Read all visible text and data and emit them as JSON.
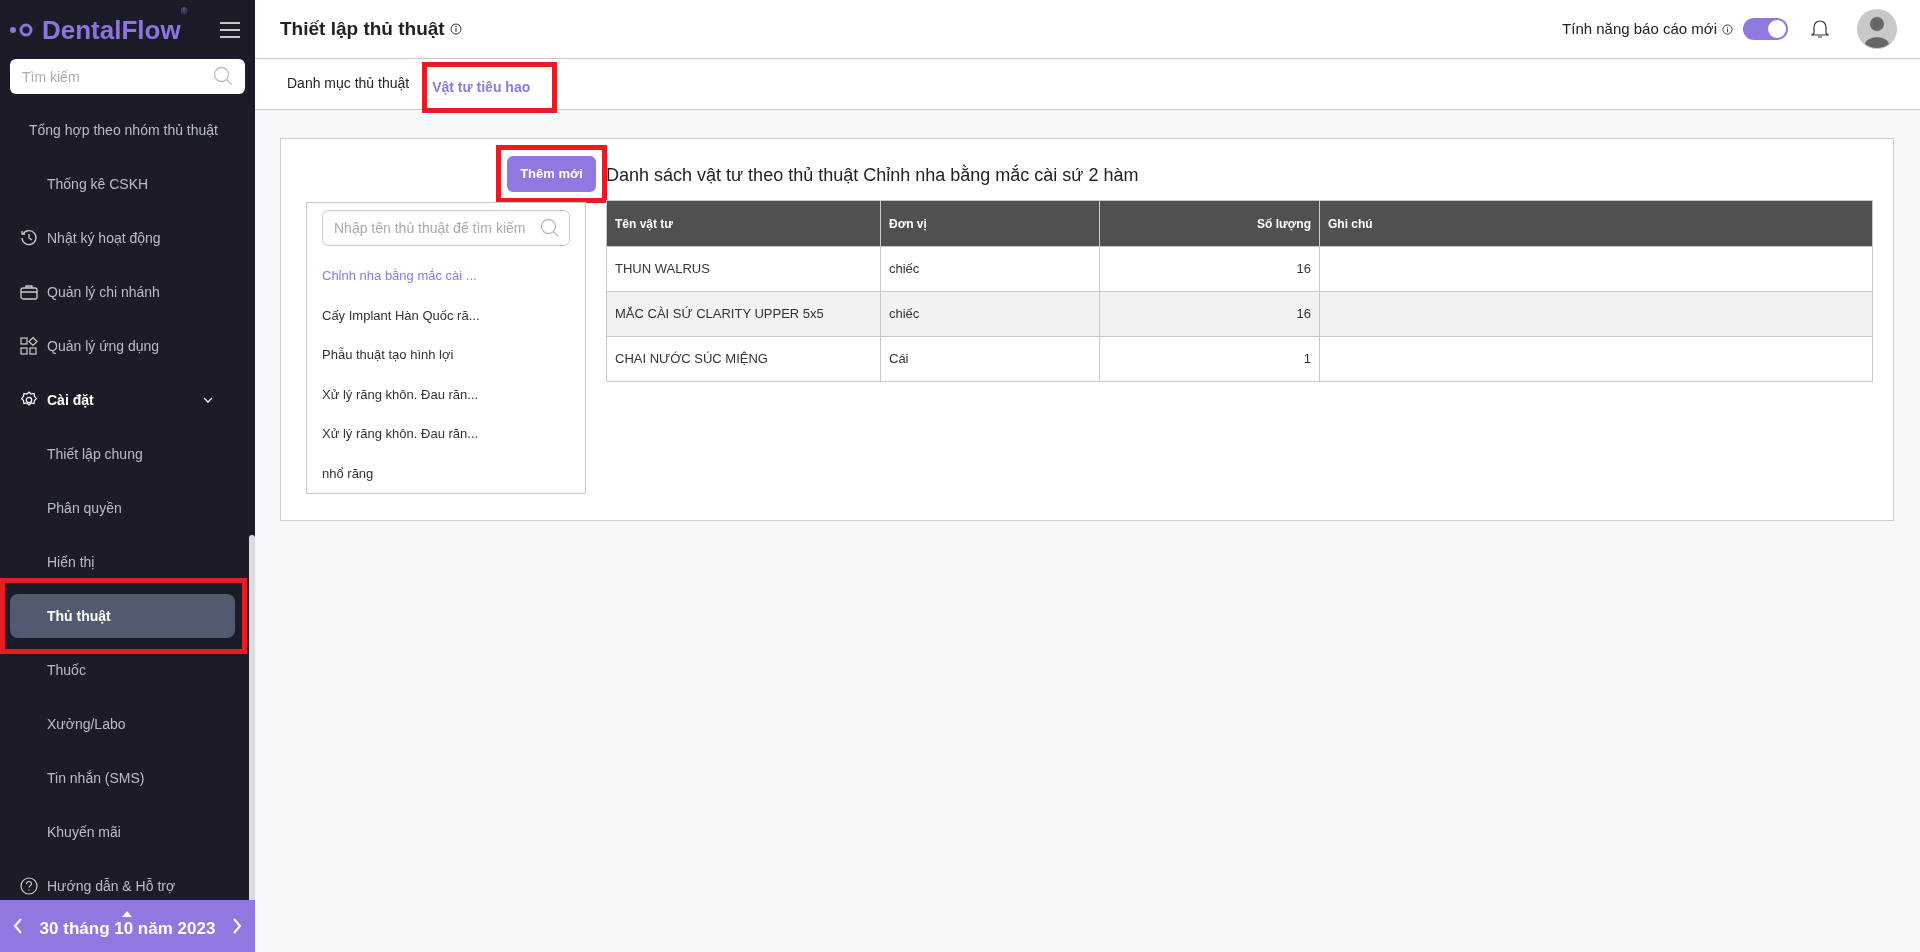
{
  "sidebar": {
    "logo": "DentalFlow$^{®}$",
    "search": {
      "placeholder": "Tìm kiếm"
    },
    "items": [
      {
        "label": "Tổng hợp theo nhóm thủ thuật",
        "kind": "sub",
        "selected": false,
        "highlighted": false
      },
      {
        "label": "Thống kê CSKH",
        "kind": "sub",
        "selected": false,
        "highlighted": false
      },
      {
        "label": "Nhật ký hoạt động",
        "kind": "section",
        "selected": false,
        "highlighted": false
      },
      {
        "label": "Quản lý chi nhánh",
        "kind": "section",
        "selected": false,
        "highlighted": false
      },
      {
        "label": "Quản lý ứng dụng",
        "kind": "section",
        "selected": false,
        "highlighted": false
      },
      {
        "label": "Cài đặt",
        "kind": "section",
        "selected": false,
        "highlighted": false,
        "expanded": true
      },
      {
        "label": "Thiết lập chung",
        "kind": "sub",
        "selected": false,
        "highlighted": false
      },
      {
        "label": "Phân quyền",
        "kind": "sub",
        "selected": false,
        "highlighted": false
      },
      {
        "label": "Hiển thị",
        "kind": "sub",
        "selected": false,
        "highlighted": false
      },
      {
        "label": "Thủ thuật",
        "kind": "sub",
        "selected": true,
        "highlighted": true
      },
      {
        "label": "Thuốc",
        "kind": "sub",
        "selected": false,
        "highlighted": false
      },
      {
        "label": "Xưởng/Labo",
        "kind": "sub",
        "selected": false,
        "highlighted": false
      },
      {
        "label": "Tin nhắn (SMS)",
        "kind": "sub",
        "selected": false,
        "highlighted": false
      },
      {
        "label": "Khuyến mãi",
        "kind": "sub",
        "selected": false,
        "highlighted": false
      },
      {
        "label": "Hướng dẫn & Hỗ trợ",
        "kind": "section",
        "selected": false,
        "highlighted": false
      }
    ],
    "date": "30 tháng 10 năm 2023"
  },
  "header": {
    "title": "Thiết lập thủ thuật",
    "toggle": {
      "label": "Tính năng báo cáo mới",
      "on": true
    }
  },
  "tabs": [
    {
      "label": "Danh mục thủ thuật",
      "selected": false,
      "highlighted": false
    },
    {
      "label": "Vật tư tiêu hao",
      "selected": true,
      "highlighted": true
    }
  ],
  "add_button": {
    "label": "Thêm mới",
    "highlighted": true
  },
  "procedures": {
    "search": {
      "placeholder": "Nhập tên thủ thuật để tìm kiếm"
    },
    "items": [
      {
        "label": "Chỉnh nha bằng mắc cài ...",
        "selected": true
      },
      {
        "label": "Cấy Implant Hàn Quốc ră...",
        "selected": false
      },
      {
        "label": "Phẫu thuật tạo hình lợi",
        "selected": false
      },
      {
        "label": "Xử lý răng khôn. Đau răn...",
        "selected": false
      },
      {
        "label": "Xử lý răng khôn. Đau răn...",
        "selected": false
      },
      {
        "label": "nhổ răng",
        "selected": false
      }
    ]
  },
  "table": {
    "title": "Danh sách vật tư theo thủ thuật Chỉnh nha bằng mắc cài sứ 2 hàm",
    "columns": [
      "Tên vật tư",
      "Đơn vị",
      "Số lượng",
      "Ghi chú"
    ],
    "rows": [
      [
        "THUN WALRUS",
        "chiếc",
        "16",
        ""
      ],
      [
        "MẮC CÀI SỨ CLARITY UPPER 5x5",
        "chiếc",
        "16",
        ""
      ],
      [
        "CHAI NƯỚC SÚC MIỆNG",
        "Cái",
        "1",
        ""
      ]
    ]
  }
}
